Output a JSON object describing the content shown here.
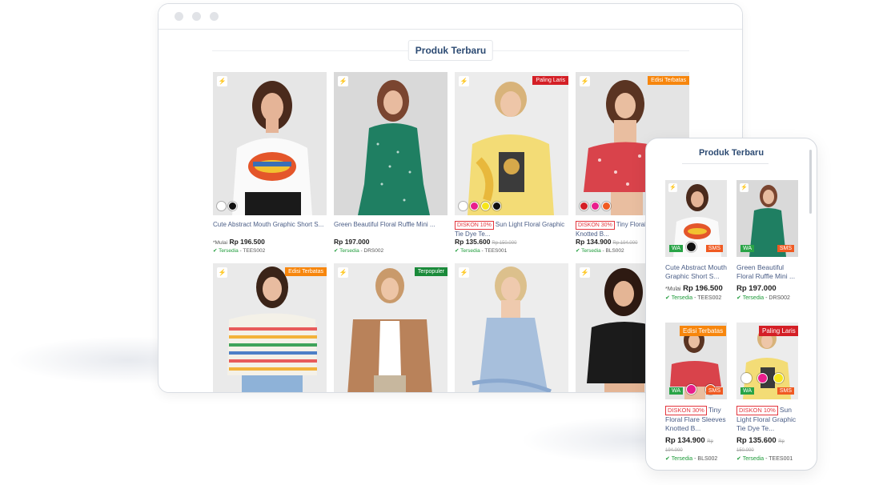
{
  "section_title": "Produk Terbaru",
  "desktop": {
    "products": [
      {
        "name": "Cute Abstract Mouth Graphic Short S...",
        "price_prefix": "*Mulai",
        "price": "Rp 196.500",
        "stock": "Tersedia",
        "sku": "TEES002",
        "flash": "⚡",
        "swatches": [
          "#ffffff",
          "#111111"
        ]
      },
      {
        "name": "Green Beautiful Floral Ruffle Mini ...",
        "price": "Rp 197.000",
        "stock": "Tersedia",
        "sku": "DRS002",
        "flash": "⚡"
      },
      {
        "discount": "DISKON 10%",
        "name": "Sun Light Floral Graphic Tie Dye Te...",
        "price": "Rp 135.600",
        "old_price": "Rp 150.000",
        "stock": "Tersedia",
        "sku": "TEES001",
        "badge": "Paling Laris",
        "flash": "⚡",
        "swatches": [
          "#ffffff",
          "#e91e8c",
          "#f6e61a",
          "#111111"
        ]
      },
      {
        "discount": "DISKON 30%",
        "name": "Tiny Floral Flare Sleeves Knotted B...",
        "price": "Rp 134.900",
        "old_price": "Rp 194.000",
        "stock": "Tersedia",
        "sku": "BLS002",
        "badge": "Edisi Terbatas",
        "flash": "⚡",
        "swatches": [
          "#d41f26",
          "#e91e8c",
          "#f05a22"
        ]
      },
      {
        "badge": "Edisi Terbatas",
        "flash": "⚡"
      },
      {
        "badge": "Terpopuler",
        "flash": "⚡"
      },
      {
        "flash": "⚡"
      },
      {
        "flash": "⚡"
      }
    ]
  },
  "mobile": {
    "title": "Produk Terbaru",
    "wa_label": "WA",
    "sms_label": "SMS",
    "products": [
      {
        "name": "Cute Abstract Mouth Graphic Short S...",
        "price_prefix": "*Mulai",
        "price": "Rp 196.500",
        "stock": "Tersedia",
        "sku": "TEES002",
        "flash": "⚡",
        "swatches": [
          "#ffffff",
          "#111111"
        ]
      },
      {
        "name": "Green Beautiful Floral Ruffle Mini ...",
        "price": "Rp 197.000",
        "stock": "Tersedia",
        "sku": "DRS002",
        "flash": "⚡"
      },
      {
        "discount": "DISKON 30%",
        "name": "Tiny Floral Flare Sleeves Knotted B...",
        "price": "Rp 134.900",
        "old_price": "Rp 194.000",
        "stock": "Tersedia",
        "sku": "BLS002",
        "badge": "Edisi Terbatas",
        "swatches": [
          "#d41f26",
          "#e91e8c",
          "#f05a22"
        ]
      },
      {
        "discount": "DISKON 10%",
        "name": "Sun Light Floral Graphic Tie Dye Te...",
        "price": "Rp 135.600",
        "old_price": "Rp 150.000",
        "stock": "Tersedia",
        "sku": "TEES001",
        "badge": "Paling Laris",
        "swatches": [
          "#ffffff",
          "#e91e8c",
          "#f6e61a"
        ]
      }
    ]
  },
  "colors": {
    "title": "#2d4b73",
    "discount": "#e3353d",
    "paling_laris": "#d41f26",
    "edisi_terbatas": "#f7860d",
    "terpopuler": "#1a8a3a",
    "wa": "#29a447",
    "sms": "#f05a22"
  }
}
